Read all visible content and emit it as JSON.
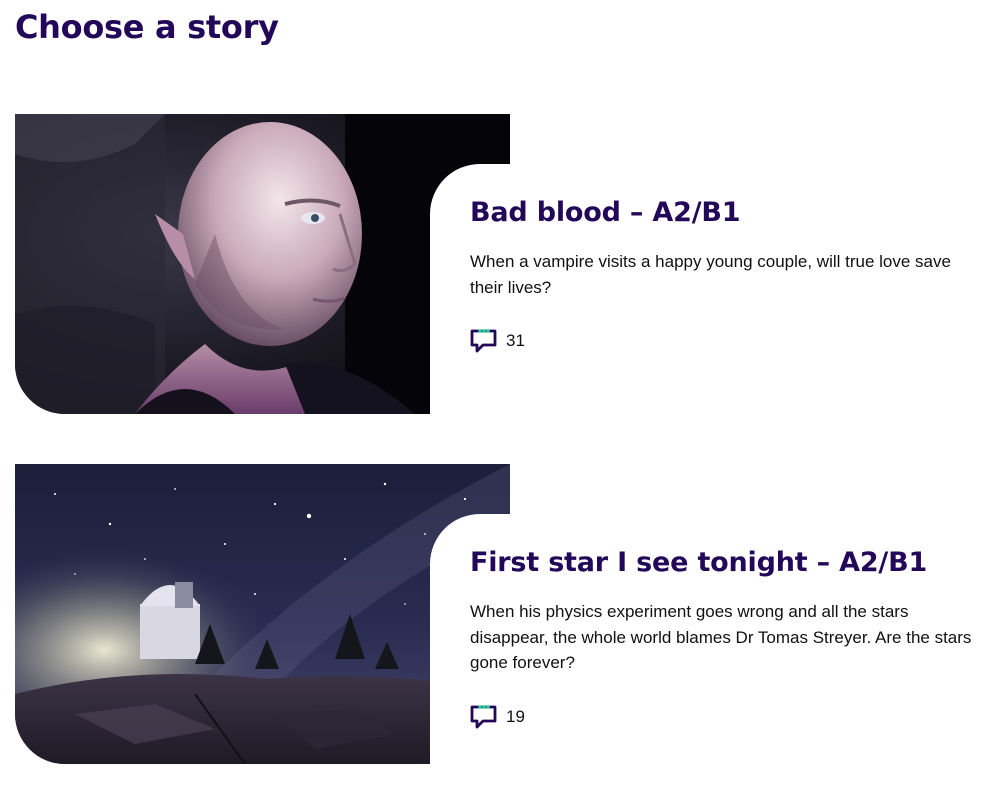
{
  "page": {
    "title": "Choose a story"
  },
  "stories": [
    {
      "title": "Bad blood – A2/B1",
      "description": "When a vampire visits a happy young couple, will true love save their lives?",
      "comments": "31",
      "image_icon": "vampire-portrait-image"
    },
    {
      "title": "First star I see tonight – A2/B1",
      "description": "When his physics experiment goes wrong and all the stars disappear, the whole world blames Dr Tomas Streyer. Are the stars gone forever?",
      "comments": "19",
      "image_icon": "observatory-night-sky-image"
    }
  ],
  "icons": {
    "comment": "speech-bubble-icon"
  },
  "colors": {
    "heading": "#23085a",
    "text": "#111111",
    "icon_dots": "#2ad0a0"
  }
}
